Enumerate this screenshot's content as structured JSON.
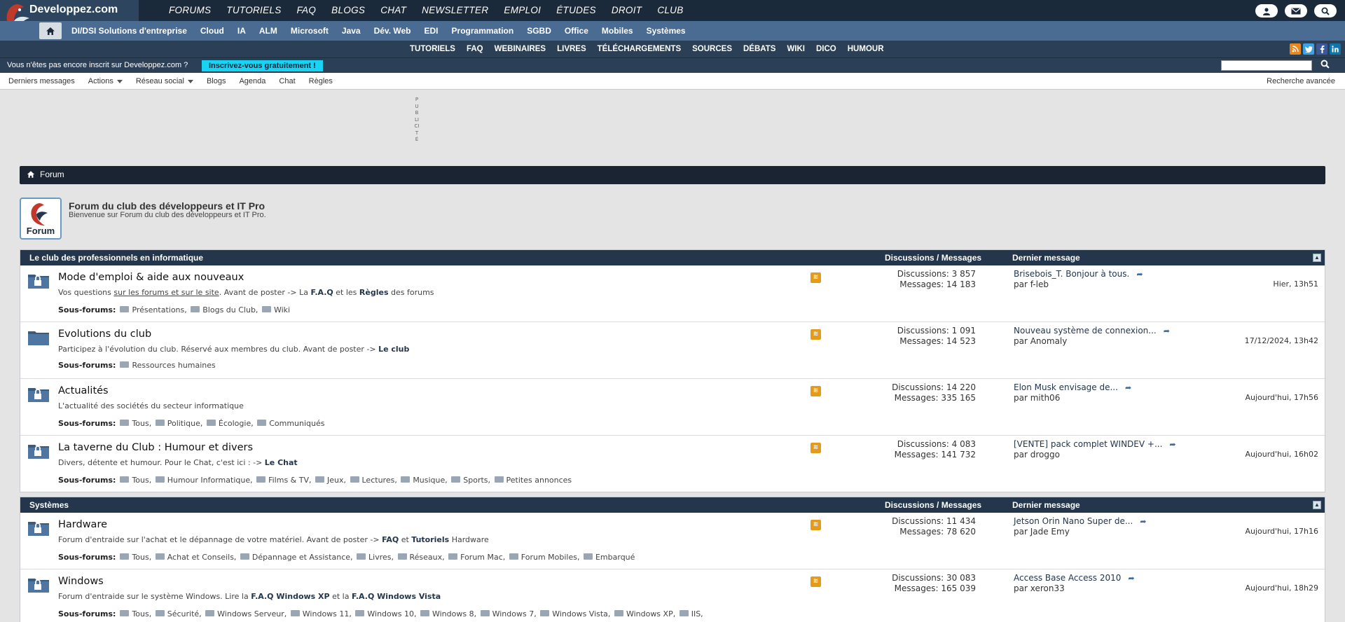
{
  "site": {
    "name": "Developpez.com",
    "main_nav": [
      "FORUMS",
      "TUTORIELS",
      "FAQ",
      "BLOGS",
      "CHAT",
      "NEWSLETTER",
      "EMPLOI",
      "ÉTUDES",
      "DROIT",
      "CLUB"
    ],
    "sub_nav": [
      "DI/DSI Solutions d'entreprise",
      "Cloud",
      "IA",
      "ALM",
      "Microsoft",
      "Java",
      "Dév. Web",
      "EDI",
      "Programmation",
      "SGBD",
      "Office",
      "Mobiles",
      "Systèmes"
    ],
    "third_nav": [
      "TUTORIELS",
      "FAQ",
      "WEBINAIRES",
      "LIVRES",
      "TÉLÉCHARGEMENTS",
      "SOURCES",
      "DÉBATS",
      "WIKI",
      "DICO",
      "HUMOUR"
    ],
    "register_text": "Vous n'êtes pas encore inscrit sur Developpez.com ?",
    "register_button": "Inscrivez-vous gratuitement !",
    "toolbar": [
      "Derniers messages",
      "Actions",
      "Réseau social",
      "Blogs",
      "Agenda",
      "Chat",
      "Règles"
    ],
    "advanced_search": "Recherche avancée",
    "ad_label": "PUBLICITÉ",
    "logo_text": "Forum"
  },
  "breadcrumb": "Forum",
  "forum": {
    "title": "Forum du club des développeurs et IT Pro",
    "subtitle": "Bienvenue sur Forum du club des développeurs et IT Pro."
  },
  "categories": [
    {
      "name": "Le club des professionnels en informatique",
      "col_stats": "Discussions / Messages",
      "col_last": "Dernier message",
      "forums": [
        {
          "title": "Mode d'emploi & aide aux nouveaux",
          "desc_parts": [
            "Vos questions ",
            "sur les forums et sur le site",
            ". Avant de poster -> La ",
            "F.A.Q",
            " et les ",
            "Règles",
            " des forums"
          ],
          "subforums_label": "Sous-forums:",
          "subforums": [
            "Présentations,",
            "Blogs du Club,",
            "Wiki"
          ],
          "discussions": "Discussions: 3 857",
          "messages": "Messages: 14 183",
          "last_title": "Brisebois_T. Bonjour à tous.",
          "last_by": "par f-leb",
          "last_date": "Hier, 13h51"
        },
        {
          "title": "Evolutions du club",
          "desc_parts": [
            "Participez à l'évolution du club. Réservé aux membres du club. Avant de poster -> ",
            "Le club"
          ],
          "subforums_label": "Sous-forums:",
          "subforums": [
            "Ressources humaines"
          ],
          "discussions": "Discussions: 1 091",
          "messages": "Messages: 14 523",
          "last_title": "Nouveau système de connexion...",
          "last_by": "par Anomaly",
          "last_date": "17/12/2024, 13h42"
        },
        {
          "title": "Actualités",
          "desc_parts": [
            "L'actualité des sociétés du secteur informatique"
          ],
          "subforums_label": "Sous-forums:",
          "subforums": [
            "Tous,",
            "Politique,",
            "Écologie,",
            "Communiqués"
          ],
          "discussions": "Discussions: 14 220",
          "messages": "Messages: 335 165",
          "last_title": "Elon Musk envisage de...",
          "last_by": "par mith06",
          "last_date": "Aujourd'hui, 17h56"
        },
        {
          "title": "La taverne du Club : Humour et divers",
          "desc_parts": [
            "Divers, détente et humour. Pour le Chat, c'est ici : -> ",
            "Le Chat"
          ],
          "subforums_label": "Sous-forums:",
          "subforums": [
            "Tous,",
            "Humour Informatique,",
            "Films & TV,",
            "Jeux,",
            "Lectures,",
            "Musique,",
            "Sports,",
            "Petites annonces"
          ],
          "discussions": "Discussions: 4 083",
          "messages": "Messages: 141 732",
          "last_title": "[VENTE] pack complet WINDEV +...",
          "last_by": "par droggo",
          "last_date": "Aujourd'hui, 16h02"
        }
      ]
    },
    {
      "name": "Systèmes",
      "col_stats": "Discussions / Messages",
      "col_last": "Dernier message",
      "forums": [
        {
          "title": "Hardware",
          "desc_parts": [
            "Forum d'entraide sur l'achat et le dépannage de votre matériel. Avant de poster -> ",
            "FAQ",
            " et ",
            "Tutoriels",
            " Hardware"
          ],
          "subforums_label": "Sous-forums:",
          "subforums": [
            "Tous,",
            "Achat et Conseils,",
            "Dépannage et Assistance,",
            "Livres,",
            "Réseaux,",
            "Forum Mac,",
            "Forum Mobiles,",
            "Embarqué"
          ],
          "discussions": "Discussions: 11 434",
          "messages": "Messages: 78 620",
          "last_title": "Jetson Orin Nano Super de...",
          "last_by": "par Jade Emy",
          "last_date": "Aujourd'hui, 17h16"
        },
        {
          "title": "Windows",
          "desc_parts": [
            "Forum d'entraide sur le système Windows. Lire la ",
            "F.A.Q Windows XP",
            " et la ",
            "F.A.Q Windows Vista"
          ],
          "subforums_label": "Sous-forums:",
          "subforums": [
            "Tous,",
            "Sécurité,",
            "Windows Serveur,",
            "Windows 11,",
            "Windows 10,",
            "Windows 8,",
            "Windows 7,",
            "Windows Vista,",
            "Windows XP,",
            "IIS,"
          ],
          "discussions": "Discussions: 30 083",
          "messages": "Messages: 165 039",
          "last_title": "Access Base Access 2010",
          "last_by": "par xeron33",
          "last_date": "Aujourd'hui, 18h29"
        }
      ]
    }
  ]
}
